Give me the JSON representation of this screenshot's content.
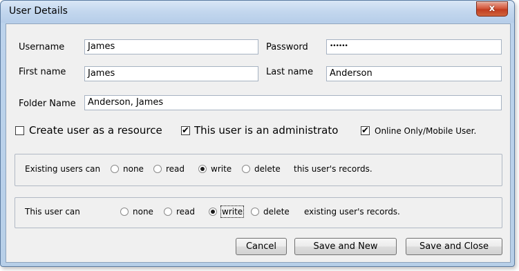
{
  "window": {
    "title": "User Details",
    "close_glyph": "x"
  },
  "form": {
    "username_label": "Username",
    "username_value": "James",
    "password_label": "Password",
    "password_value": "••••••",
    "first_name_label": "First name",
    "first_name_value": "James",
    "last_name_label": "Last name",
    "last_name_value": "Anderson",
    "folder_name_label": "Folder Name",
    "folder_name_value": "Anderson, James"
  },
  "options": {
    "resource": {
      "label": "Create user as a resource",
      "checked": false
    },
    "admin": {
      "label": "This user is an administrato",
      "checked": true
    },
    "online": {
      "label": "Online Only/Mobile User.",
      "checked": true
    }
  },
  "existing_group": {
    "prefix": "Existing users can",
    "choices": [
      "none",
      "read",
      "write",
      "delete"
    ],
    "selected": "write",
    "suffix": "this user's records."
  },
  "this_user_group": {
    "prefix": "This user can",
    "choices": [
      "none",
      "read",
      "write",
      "delete"
    ],
    "selected": "write",
    "suffix": "existing user's records."
  },
  "buttons": {
    "cancel": "Cancel",
    "save_new": "Save and New",
    "save_close": "Save and Close"
  },
  "colors": {
    "titlebar": "#c3d7ee",
    "close_button": "#c13d20",
    "client_bg": "#f0f0f0"
  },
  "icons": {
    "close": "close-icon",
    "check": "checkmark-icon"
  }
}
